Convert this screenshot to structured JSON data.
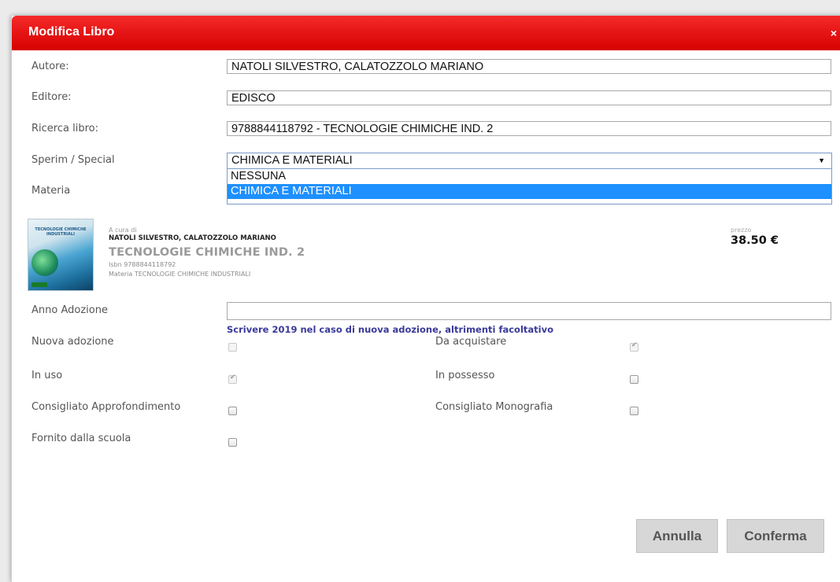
{
  "dialog": {
    "title": "Modifica Libro",
    "close": "×"
  },
  "fields": {
    "autore": {
      "label": "Autore:",
      "value": "NATOLI SILVESTRO, CALATOZZOLO MARIANO"
    },
    "editore": {
      "label": "Editore:",
      "value": "EDISCO"
    },
    "ricerca": {
      "label": "Ricerca libro:",
      "value": "9788844118792 - TECNOLOGIE CHIMICHE IND. 2"
    },
    "sperim": {
      "label": "Sperim / Special",
      "selected": "CHIMICA E MATERIALI",
      "options": [
        "NESSUNA",
        "CHIMICA E MATERIALI"
      ],
      "highlighted": "CHIMICA E MATERIALI"
    },
    "materia": {
      "label": "Materia"
    }
  },
  "book": {
    "cover_title": "TECNOLOGIE CHIMICHE INDUSTRIALI",
    "a_cura_di": "A cura di",
    "authors": "NATOLI SILVESTRO, CALATOZZOLO MARIANO",
    "title": "TECNOLOGIE CHIMICHE IND. 2",
    "isbn": "Isbn 9788844118792",
    "materia": "Materia TECNOLOGIE CHIMICHE INDUSTRIALI",
    "prezzo_label": "prezzo",
    "prezzo": "38.50 €"
  },
  "anno": {
    "label": "Anno Adozione",
    "value": "",
    "hint": "Scrivere 2019 nel caso di nuova adozione, altrimenti facoltativo"
  },
  "checks": {
    "nuova_adozione": {
      "label": "Nuova adozione",
      "checked": false
    },
    "da_acquistare": {
      "label": "Da acquistare",
      "checked": true
    },
    "in_uso": {
      "label": "In uso",
      "checked": true
    },
    "in_possesso": {
      "label": "In possesso",
      "checked": false
    },
    "consigliato_approfondimento": {
      "label": "Consigliato Approfondimento",
      "checked": false
    },
    "consigliato_monografia": {
      "label": "Consigliato Monografia",
      "checked": false
    },
    "fornito_scuola": {
      "label": "Fornito dalla scuola",
      "checked": false
    }
  },
  "buttons": {
    "annulla": "Annulla",
    "conferma": "Conferma"
  },
  "colors": {
    "titlebar": "#e60000",
    "selected_option": "#1e90ff",
    "hint": "#3a3a9a"
  }
}
